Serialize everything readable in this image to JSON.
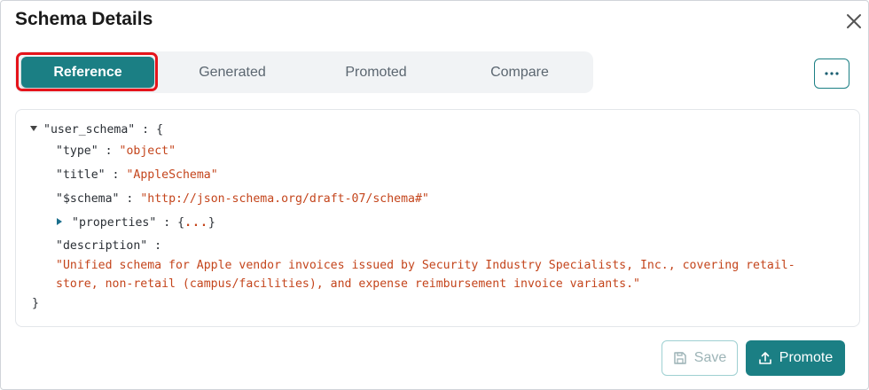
{
  "dialog": {
    "title": "Schema Details"
  },
  "tabs": [
    {
      "label": "Reference",
      "active": true
    },
    {
      "label": "Generated",
      "active": false
    },
    {
      "label": "Promoted",
      "active": false
    },
    {
      "label": "Compare",
      "active": false
    }
  ],
  "icons": {
    "close": "close-icon",
    "more": "more-horizontal-icon",
    "save": "save-icon",
    "promote": "upload-icon"
  },
  "schema": {
    "root_key": "\"user_schema\"",
    "open_brace": "{",
    "close_brace": "}",
    "type_key": "\"type\"",
    "type_value": "\"object\"",
    "title_key": "\"title\"",
    "title_value": "\"AppleSchema\"",
    "schema_key": "\"$schema\"",
    "schema_value": "\"http://json-schema.org/draft-07/schema#\"",
    "properties_key": "\"properties\"",
    "properties_collapsed": "...",
    "description_key": "\"description\"",
    "description_value": "\"Unified schema for Apple vendor invoices issued by Security Industry Specialists, Inc., covering retail-store, non-retail (campus/facilities), and expense reimbursement invoice variants.\"",
    "separator": ":"
  },
  "footer": {
    "save_label": "Save",
    "promote_label": "Promote"
  },
  "colors": {
    "accent": "#1b7f84",
    "string": "#c4451c",
    "highlight_border": "#e5141b"
  }
}
